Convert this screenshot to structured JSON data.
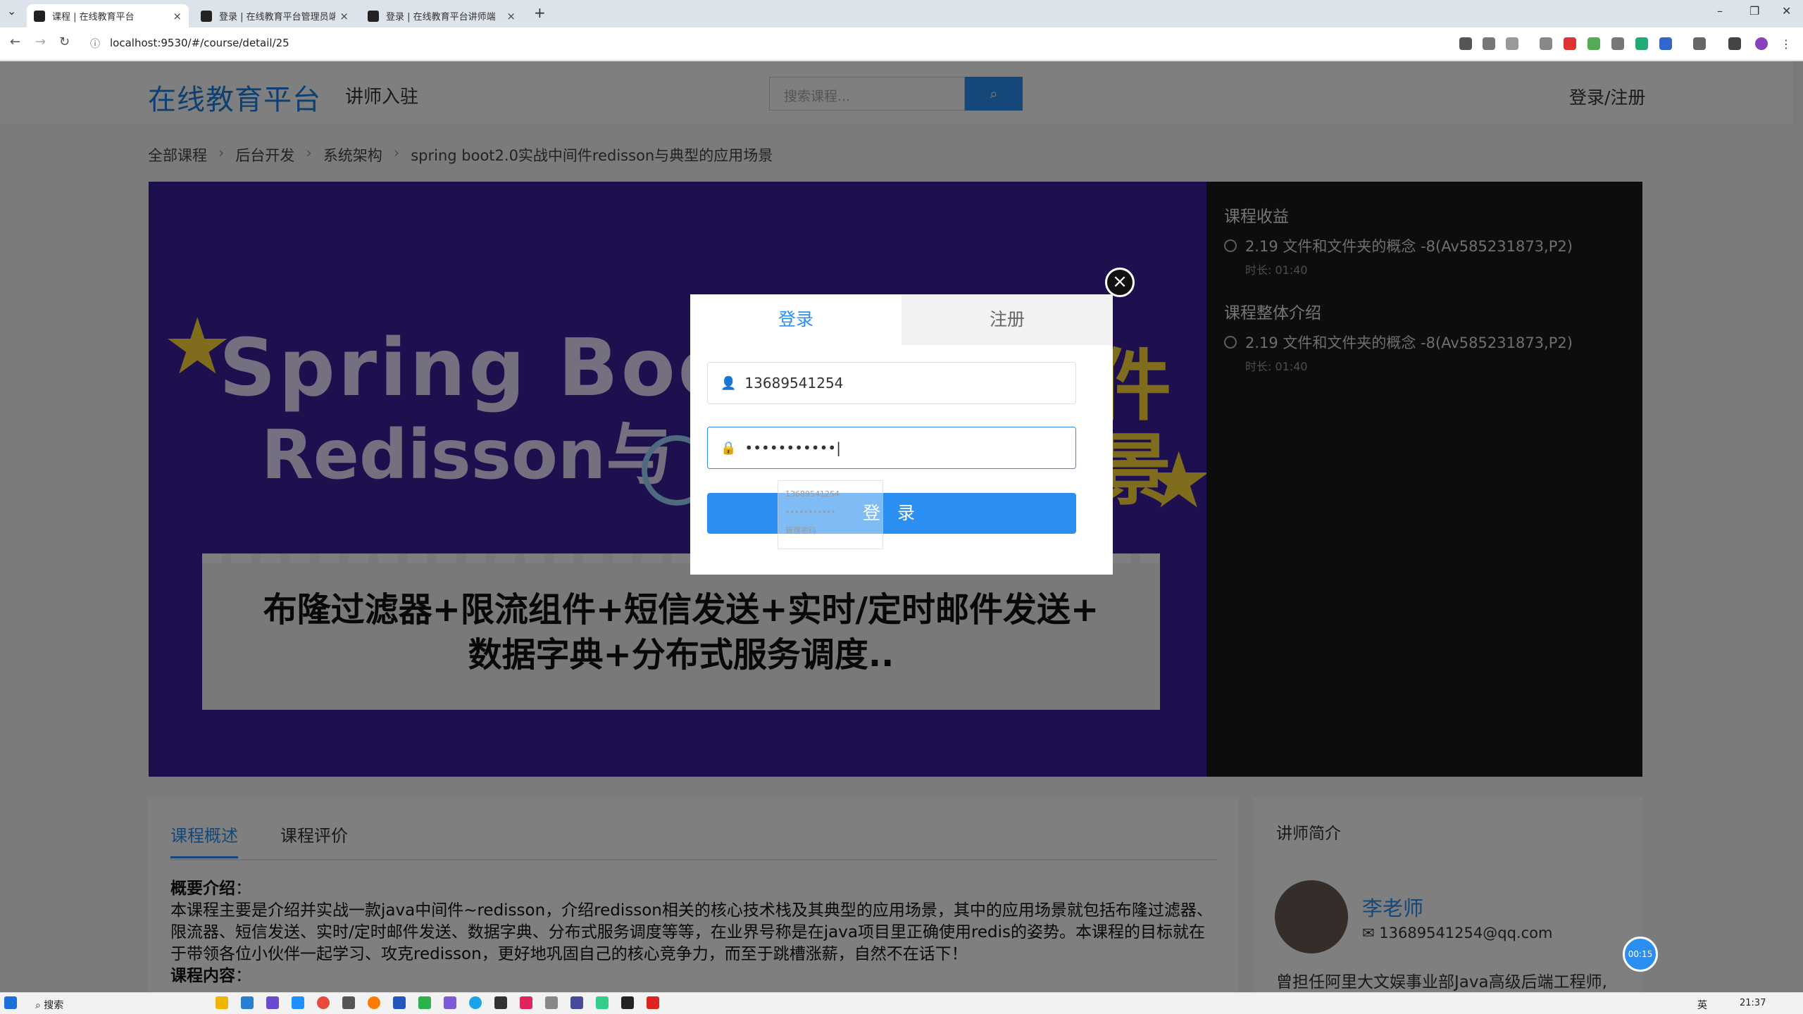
{
  "browser": {
    "tabs": [
      {
        "title": "课程 | 在线教育平台",
        "active": true
      },
      {
        "title": "登录 | 在线教育平台管理员端",
        "active": false
      },
      {
        "title": "登录 | 在线教育平台讲师端",
        "active": false
      }
    ],
    "url": "localhost:9530/#/course/detail/25",
    "new_tab": "+"
  },
  "header": {
    "brand": "在线教育平台",
    "teacher_link": "讲师入驻",
    "search_placeholder": "搜索课程...",
    "login_register": "登录/注册"
  },
  "breadcrumb": [
    "全部课程",
    "后台开发",
    "系统架构",
    "spring boot2.0实战中间件redisson与典型的应用场景"
  ],
  "hero": {
    "line1": "Spring Boot2",
    "line2": "Redisson与",
    "side1": "件",
    "side2": "景",
    "banner_line1": "布隆过滤器+限流组件+短信发送+实时/定时邮件发送+",
    "banner_line2": "数据字典+分布式服务调度.."
  },
  "side_panel": {
    "section1": "课程收益",
    "section2": "课程整体介绍",
    "item": "2.19 文件和文件夹的概念 -8(Av585231873,P2)",
    "duration": "时长: 01:40"
  },
  "course_tabs": [
    "课程概述",
    "课程评价"
  ],
  "intro": {
    "summary_label": "概要介绍",
    "summary_text": "本课程主要是介绍并实战一款java中间件~redisson，介绍redisson相关的核心技术栈及其典型的应用场景，其中的应用场景就包括布隆过滤器、限流器、短信发送、实时/定时邮件发送、数据字典、分布式服务调度等等，在业界号称是在java项目里正确使用redis的姿势。本课程的目标就在于带领各位小伙伴一起学习、攻克redisson，更好地巩固自己的核心竞争力，而至于跳槽涨薪，自然不在话下！",
    "content_label": "课程内容"
  },
  "lecturer": {
    "title": "讲师简介",
    "name": "李老师",
    "email": "13689541254@qq.com",
    "desc": "曾担任阿里大文娱事业部Java高级后端工程师,"
  },
  "timer": "00:15",
  "modal": {
    "tab_login": "登录",
    "tab_register": "注册",
    "phone_value": "13689541254",
    "password_value": "•••••••••••",
    "submit": "登 录",
    "close": "×",
    "autofill_user": "13689541254",
    "autofill_pwd": "•••••••••••",
    "autofill_manage": "管理密码"
  },
  "taskbar": {
    "search": "搜索",
    "ime": "英",
    "time": "21:37"
  },
  "colors": {
    "accent": "#2a8ff0",
    "hero_bg": "#3d1f9c",
    "highlight": "#ffd93b"
  }
}
